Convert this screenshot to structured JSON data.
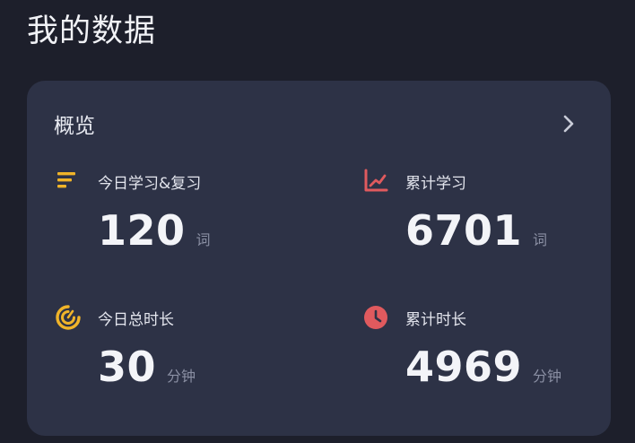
{
  "page": {
    "title": "我的数据"
  },
  "card": {
    "title": "概览",
    "more_icon": "chevron-right-icon"
  },
  "stats": [
    {
      "label": "今日学习&复习",
      "value": "120",
      "unit": "词",
      "icon": "bars-list-icon",
      "color": "#f0b429"
    },
    {
      "label": "累计学习",
      "value": "6701",
      "unit": "词",
      "icon": "line-chart-icon",
      "color": "#e05a5e"
    },
    {
      "label": "今日总时长",
      "value": "30",
      "unit": "分钟",
      "icon": "gauge-icon",
      "color": "#f0b429"
    },
    {
      "label": "累计时长",
      "value": "4969",
      "unit": "分钟",
      "icon": "clock-icon",
      "color": "#e05a5e"
    }
  ]
}
